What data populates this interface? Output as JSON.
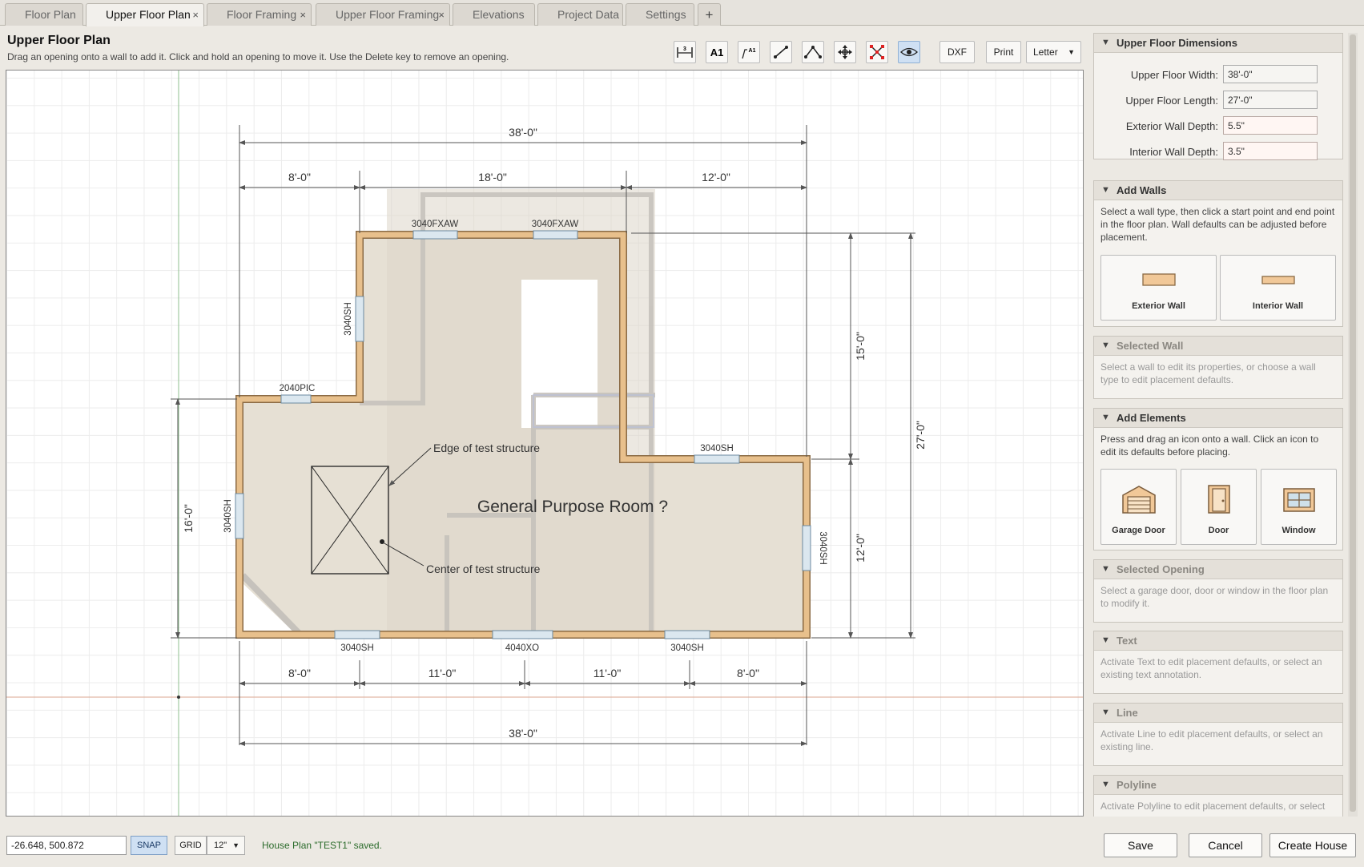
{
  "tabs": [
    {
      "label": "Floor Plan",
      "closable": false
    },
    {
      "label": "Upper Floor Plan",
      "closable": true,
      "active": true
    },
    {
      "label": "Floor Framing",
      "closable": true
    },
    {
      "label": "Upper Floor Framing",
      "closable": true
    },
    {
      "label": "Elevations",
      "closable": false
    },
    {
      "label": "Project Data",
      "closable": false
    },
    {
      "label": "Settings",
      "closable": false
    }
  ],
  "tab_close_glyph": "×",
  "tab_add_glyph": "+",
  "header": {
    "title": "Upper Floor Plan",
    "subtitle": "Drag an opening onto a wall to add it. Click and hold an opening to move it. Use the Delete key to remove an opening."
  },
  "toolbar": {
    "tools": [
      "dimension-icon",
      "text-a1-icon",
      "leader-text-icon",
      "line-icon",
      "polyline-icon",
      "move-icon",
      "delete-icon",
      "visibility-icon"
    ],
    "dxf_label": "DXF",
    "print_label": "Print",
    "paper_size": "Letter"
  },
  "plan": {
    "room_label": "General Purpose Room ?",
    "annotations": {
      "edge": "Edge of test structure",
      "center": "Center of test structure"
    },
    "dims": {
      "top_total": "38'-0\"",
      "top_a": "8'-0\"",
      "top_b": "18'-0\"",
      "top_c": "12'-0\"",
      "bottom_a": "8'-0\"",
      "bottom_b": "11'-0\"",
      "bottom_c": "11'-0\"",
      "bottom_d": "8'-0\"",
      "bottom_total": "38'-0\"",
      "left": "16'-0\"",
      "right_upper": "15'-0\"",
      "right_lower": "12'-0\"",
      "right_total": "27'-0\""
    },
    "openings": {
      "top_window_1": "3040FXAW",
      "top_window_2": "3040FXAW",
      "left_upper_window": "3040SH",
      "step_window": "2040PIC",
      "left_lower_window": "3040SH",
      "mid_step_window": "3040SH",
      "right_window": "3040SH",
      "bottom_window_1": "3040SH",
      "bottom_window_2": "4040XO",
      "bottom_window_3": "3040SH"
    }
  },
  "panel": {
    "dimensions": {
      "title": "Upper Floor Dimensions",
      "width_label": "Upper Floor Width:",
      "width_value": "38'-0\"",
      "length_label": "Upper Floor Length:",
      "length_value": "27'-0\"",
      "ext_wall_label": "Exterior Wall Depth:",
      "ext_wall_value": "5.5\"",
      "int_wall_label": "Interior Wall Depth:",
      "int_wall_value": "3.5\""
    },
    "add_walls": {
      "title": "Add Walls",
      "desc": "Select a wall type, then click a start point and end point in the floor plan. Wall defaults can be adjusted before placement.",
      "exterior": "Exterior Wall",
      "interior": "Interior Wall"
    },
    "selected_wall": {
      "title": "Selected Wall",
      "desc": "Select a wall to edit its properties, or choose a wall type to edit placement defaults."
    },
    "add_elements": {
      "title": "Add Elements",
      "desc": "Press and drag an icon onto a wall. Click an icon to edit its defaults before placing.",
      "garage": "Garage Door",
      "door": "Door",
      "window": "Window"
    },
    "selected_opening": {
      "title": "Selected Opening",
      "desc": "Select a garage door, door or window in the floor plan to modify it."
    },
    "text": {
      "title": "Text",
      "desc": "Activate Text to edit placement defaults, or select an existing text annotation."
    },
    "line": {
      "title": "Line",
      "desc": "Activate Line to edit placement defaults, or select an existing line."
    },
    "polyline": {
      "title": "Polyline",
      "desc": "Activate Polyline to edit placement defaults, or select"
    }
  },
  "status": {
    "coords": "-26.648, 500.872",
    "snap_label": "SNAP",
    "grid_label": "GRID",
    "grid_size": "12\"",
    "message": "House Plan \"TEST1\" saved."
  },
  "actions": {
    "save": "Save",
    "cancel": "Cancel",
    "create": "Create House"
  },
  "colors": {
    "wall": "#e8c08c",
    "wall_edge": "#8a6a44",
    "room_fill": "#e6e0d4",
    "accent": "#cfe0f3",
    "status_text": "#2b6b2b"
  }
}
